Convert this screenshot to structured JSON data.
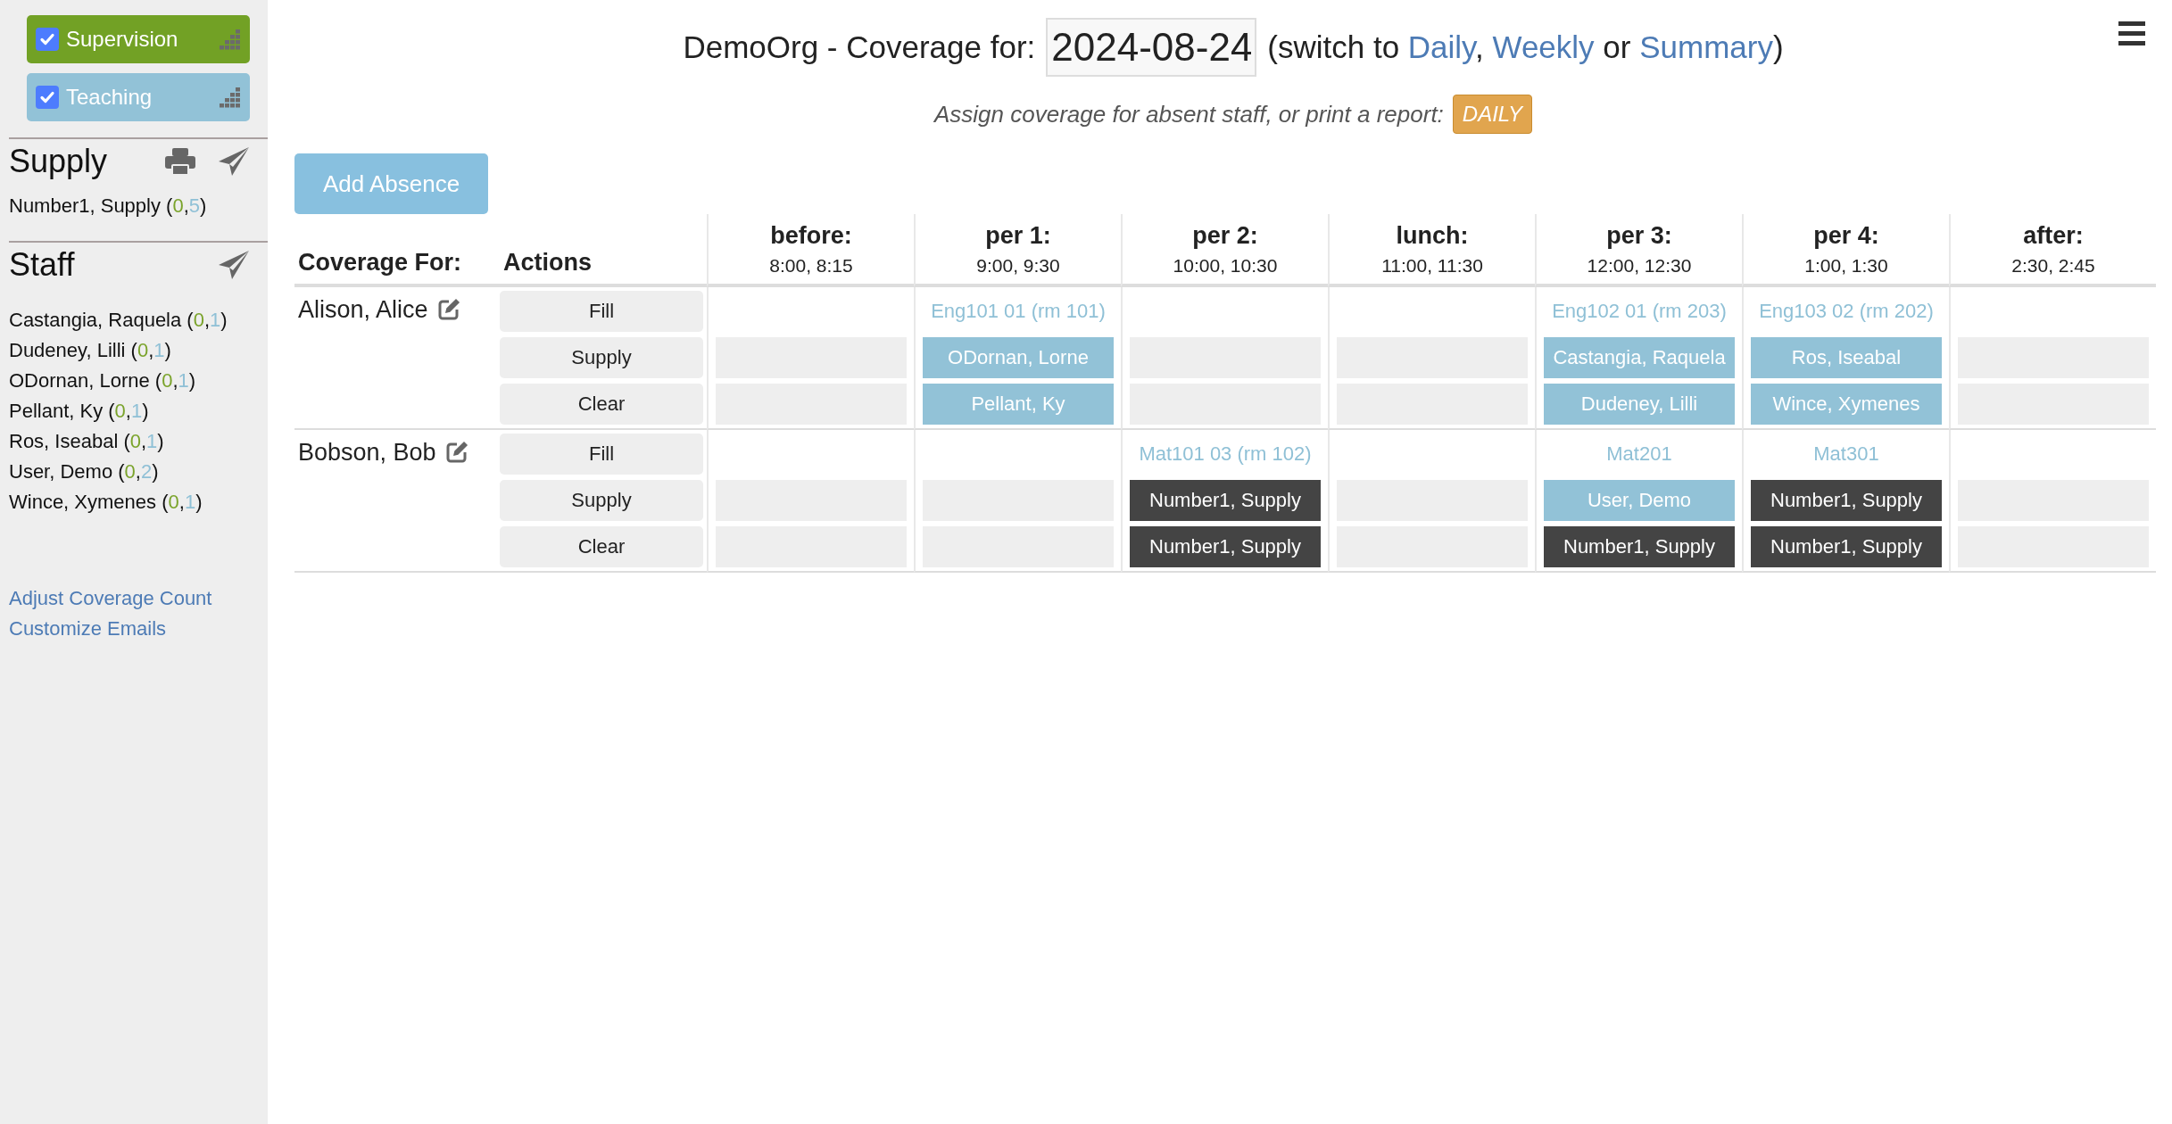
{
  "sidebar": {
    "categories": [
      {
        "label": "Supervision",
        "checked": true,
        "color": "#72a125"
      },
      {
        "label": "Teaching",
        "checked": true,
        "color": "#92c2d7"
      }
    ],
    "supply": {
      "title": "Supply",
      "people": [
        {
          "parts": [
            {
              "text": "Number1, Supply ("
            },
            {
              "text": "0",
              "kind": "supervision_count"
            },
            {
              "text": ","
            },
            {
              "text": "5",
              "kind": "teaching_count"
            },
            {
              "text": ")"
            }
          ]
        }
      ]
    },
    "staff": {
      "title": "Staff",
      "people": [
        {
          "parts": [
            {
              "text": "Castangia, Raquela ("
            },
            {
              "text": "0",
              "kind": "supervision_count"
            },
            {
              "text": ","
            },
            {
              "text": "1",
              "kind": "teaching_count"
            },
            {
              "text": ")"
            }
          ]
        },
        {
          "parts": [
            {
              "text": "Dudeney, Lilli ("
            },
            {
              "text": "0",
              "kind": "supervision_count"
            },
            {
              "text": ","
            },
            {
              "text": "1",
              "kind": "teaching_count"
            },
            {
              "text": ")"
            }
          ]
        },
        {
          "parts": [
            {
              "text": "ODornan, Lorne ("
            },
            {
              "text": "0",
              "kind": "supervision_count"
            },
            {
              "text": ","
            },
            {
              "text": "1",
              "kind": "teaching_count"
            },
            {
              "text": ")"
            }
          ]
        },
        {
          "parts": [
            {
              "text": "Pellant, Ky ("
            },
            {
              "text": "0",
              "kind": "supervision_count"
            },
            {
              "text": ","
            },
            {
              "text": "1",
              "kind": "teaching_count"
            },
            {
              "text": ")"
            }
          ]
        },
        {
          "parts": [
            {
              "text": "Ros, Iseabal ("
            },
            {
              "text": "0",
              "kind": "supervision_count"
            },
            {
              "text": ","
            },
            {
              "text": "1",
              "kind": "teaching_count"
            },
            {
              "text": ")"
            }
          ]
        },
        {
          "parts": [
            {
              "text": "User, Demo ("
            },
            {
              "text": "0",
              "kind": "supervision_count"
            },
            {
              "text": ","
            },
            {
              "text": "2",
              "kind": "teaching_count"
            },
            {
              "text": ")"
            }
          ]
        },
        {
          "parts": [
            {
              "text": "Wince, Xymenes ("
            },
            {
              "text": "0",
              "kind": "supervision_count"
            },
            {
              "text": ","
            },
            {
              "text": "1",
              "kind": "teaching_count"
            },
            {
              "text": ")"
            }
          ]
        }
      ]
    },
    "links": [
      "Adjust Coverage Count",
      "Customize Emails"
    ]
  },
  "header": {
    "title": "DemoOrg - Coverage for:",
    "date": "2024-08-24",
    "switch": [
      {
        "text": "(switch to "
      },
      {
        "text": "Daily",
        "kind": "link"
      },
      {
        "text": ", "
      },
      {
        "text": "Weekly",
        "kind": "link"
      },
      {
        "text": " or "
      },
      {
        "text": "Summary",
        "kind": "link"
      },
      {
        "text": ")"
      }
    ],
    "subtitle": "Assign coverage for absent staff, or print a report:",
    "report_button": "DAILY"
  },
  "add_button": "Add Absence",
  "table": {
    "columns": [
      "Coverage For:",
      "Actions"
    ],
    "periods": [
      {
        "name": "before:",
        "time": "8:00, 8:15"
      },
      {
        "name": "per 1:",
        "time": "9:00, 9:30"
      },
      {
        "name": "per 2:",
        "time": "10:00, 10:30"
      },
      {
        "name": "lunch:",
        "time": "11:00, 11:30"
      },
      {
        "name": "per 3:",
        "time": "12:00, 12:30"
      },
      {
        "name": "per 4:",
        "time": "1:00, 1:30"
      },
      {
        "name": "after:",
        "time": "2:30, 2:45"
      }
    ],
    "absences": [
      {
        "name": "Alison, Alice",
        "actions": [
          "Fill",
          "Supply",
          "Clear"
        ],
        "cells": [
          {
            "slots": [
              {
                "kind": "empty"
              },
              {
                "kind": "empty"
              }
            ]
          },
          {
            "class": "Eng101 01 (rm 101)",
            "slots": [
              {
                "kind": "staff",
                "name": "ODornan, Lorne"
              },
              {
                "kind": "staff",
                "name": "Pellant, Ky"
              }
            ]
          },
          {
            "slots": [
              {
                "kind": "empty"
              },
              {
                "kind": "empty"
              }
            ]
          },
          {
            "slots": [
              {
                "kind": "empty"
              },
              {
                "kind": "empty"
              }
            ]
          },
          {
            "class": "Eng102 01 (rm 203)",
            "slots": [
              {
                "kind": "staff",
                "name": "Castangia, Raquela"
              },
              {
                "kind": "staff",
                "name": "Dudeney, Lilli"
              }
            ]
          },
          {
            "class": "Eng103 02 (rm 202)",
            "slots": [
              {
                "kind": "staff",
                "name": "Ros, Iseabal"
              },
              {
                "kind": "staff",
                "name": "Wince, Xymenes"
              }
            ]
          },
          {
            "slots": [
              {
                "kind": "empty"
              },
              {
                "kind": "empty"
              }
            ]
          }
        ]
      },
      {
        "name": "Bobson, Bob",
        "actions": [
          "Fill",
          "Supply",
          "Clear"
        ],
        "cells": [
          {
            "slots": [
              {
                "kind": "empty"
              },
              {
                "kind": "empty"
              }
            ]
          },
          {
            "slots": [
              {
                "kind": "empty"
              },
              {
                "kind": "empty"
              }
            ]
          },
          {
            "class": "Mat101 03 (rm 102)",
            "slots": [
              {
                "kind": "supply",
                "name": "Number1, Supply"
              },
              {
                "kind": "supply",
                "name": "Number1, Supply"
              }
            ]
          },
          {
            "slots": [
              {
                "kind": "empty"
              },
              {
                "kind": "empty"
              }
            ]
          },
          {
            "class": "Mat201",
            "slots": [
              {
                "kind": "staff",
                "name": "User, Demo"
              },
              {
                "kind": "supply",
                "name": "Number1, Supply"
              }
            ]
          },
          {
            "class": "Mat301",
            "slots": [
              {
                "kind": "supply",
                "name": "Number1, Supply"
              },
              {
                "kind": "supply",
                "name": "Number1, Supply"
              }
            ]
          },
          {
            "slots": [
              {
                "kind": "empty"
              },
              {
                "kind": "empty"
              }
            ]
          }
        ]
      }
    ]
  }
}
